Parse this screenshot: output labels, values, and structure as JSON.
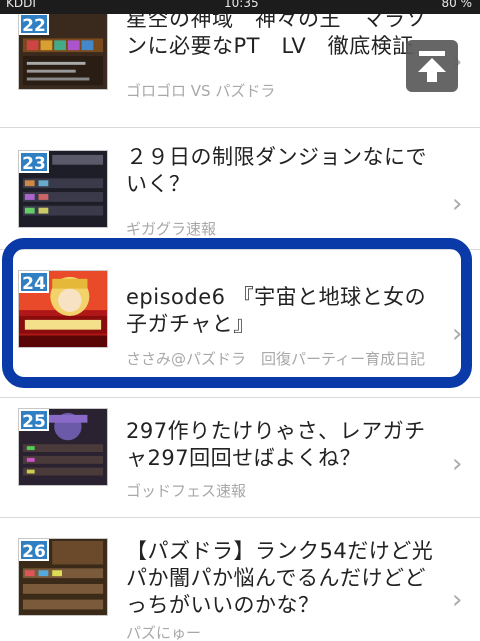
{
  "status_bar": {
    "carrier": "KDDI",
    "time": "10:35",
    "battery": "80 %"
  },
  "scroll_top_button": {
    "icon": "arrow-up-to-top-icon"
  },
  "articles": [
    {
      "rank": "22",
      "title": "星空の神域　神々の王　マラソンに必要なPT　LV　徹底検証",
      "source": "ゴロゴロ VS パズドラ"
    },
    {
      "rank": "23",
      "title": "２９日の制限ダンジョンなにでいく？",
      "source": "ギガグラ速報"
    },
    {
      "rank": "24",
      "title": "episode6 『宇宙と地球と女の子ガチャと』",
      "source": "ささみ@パズドラ　回復パーティー育成日記"
    },
    {
      "rank": "25",
      "title": "297作りたけりゃさ、レアガチャ297回回せばよくね？",
      "source": "ゴッドフェス速報"
    },
    {
      "rank": "26",
      "title": "【パズドラ】ランク54だけど光パか闇パか悩んでるんだけどどっちがいいのかな？",
      "source": "パズにゅー"
    }
  ],
  "annotation": {
    "color": "#0a3aa8"
  },
  "colors": {
    "badge": "#2f7fc2",
    "source_text": "#a8a8a8",
    "title_text": "#222222"
  }
}
